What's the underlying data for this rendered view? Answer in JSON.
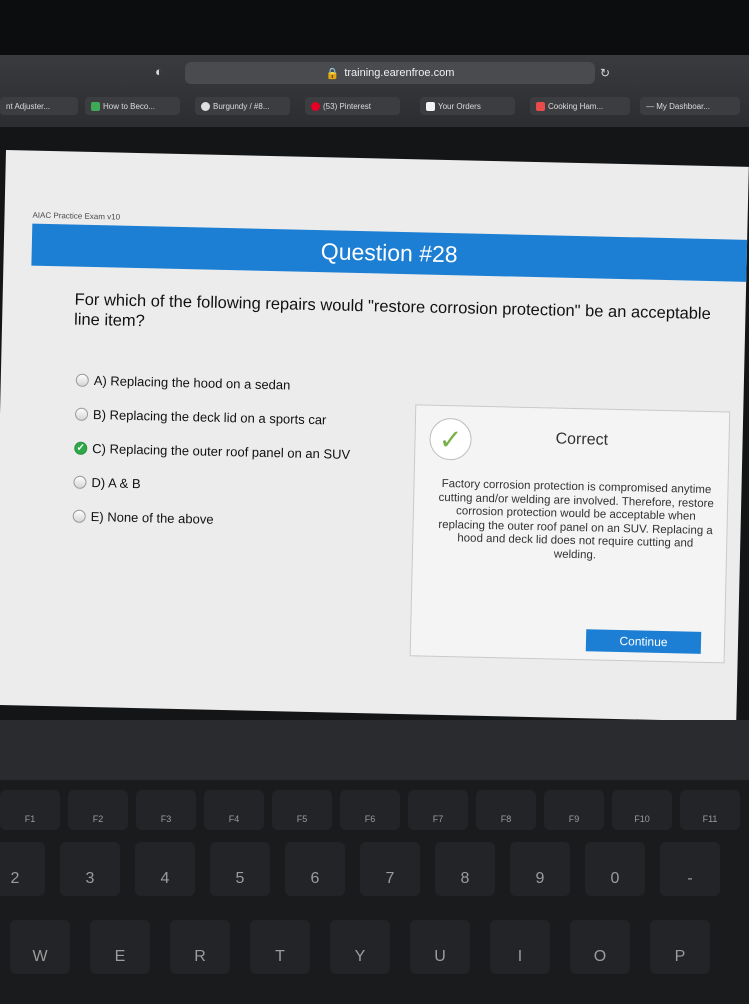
{
  "browser": {
    "url": "training.earenfroe.com",
    "bookmarks": [
      {
        "label": "nt Adjuster...",
        "color": "#6f7276"
      },
      {
        "label": "How to Beco...",
        "color": "#3eaa55"
      },
      {
        "label": "Burgundy / #8...",
        "color": "#e0e0e0"
      },
      {
        "label": "(53) Pinterest",
        "color": "#e60023"
      },
      {
        "label": "Your Orders",
        "color": "#f2f2f2"
      },
      {
        "label": "Cooking Ham...",
        "color": "#e94b4b"
      },
      {
        "label": "— My Dashboar...",
        "color": "#6f7276"
      }
    ]
  },
  "page": {
    "label": "AIAC Practice Exam v10",
    "question_title": "Question #28",
    "question_text": "For which of the following repairs would \"restore corrosion protection\" be an acceptable line item?"
  },
  "options": [
    {
      "label": "A) Replacing the hood on a sedan",
      "selected": false
    },
    {
      "label": "B) Replacing the deck lid on a sports car",
      "selected": false
    },
    {
      "label": "C) Replacing the outer roof panel on an SUV",
      "selected": true
    },
    {
      "label": "D) A & B",
      "selected": false
    },
    {
      "label": "E) None of the above",
      "selected": false
    }
  ],
  "feedback": {
    "status": "Correct",
    "explanation": "Factory corrosion protection is compromised anytime cutting and/or welding are involved. Therefore, restore corrosion protection would be acceptable when replacing the outer roof panel on an SUV. Replacing a hood and deck lid does not require cutting and welding.",
    "continue_label": "Continue",
    "check_icon": "✓"
  },
  "keyboard": {
    "function_row": [
      "F1",
      "F2",
      "F3",
      "F4",
      "F5",
      "F6",
      "F7",
      "F8",
      "F9",
      "F10",
      "F11"
    ],
    "number_row": [
      "2",
      "3",
      "4",
      "5",
      "6",
      "7",
      "8",
      "9",
      "0",
      "-"
    ],
    "letter_row": [
      "W",
      "E",
      "R",
      "T",
      "Y",
      "U",
      "I",
      "O",
      "P"
    ]
  }
}
